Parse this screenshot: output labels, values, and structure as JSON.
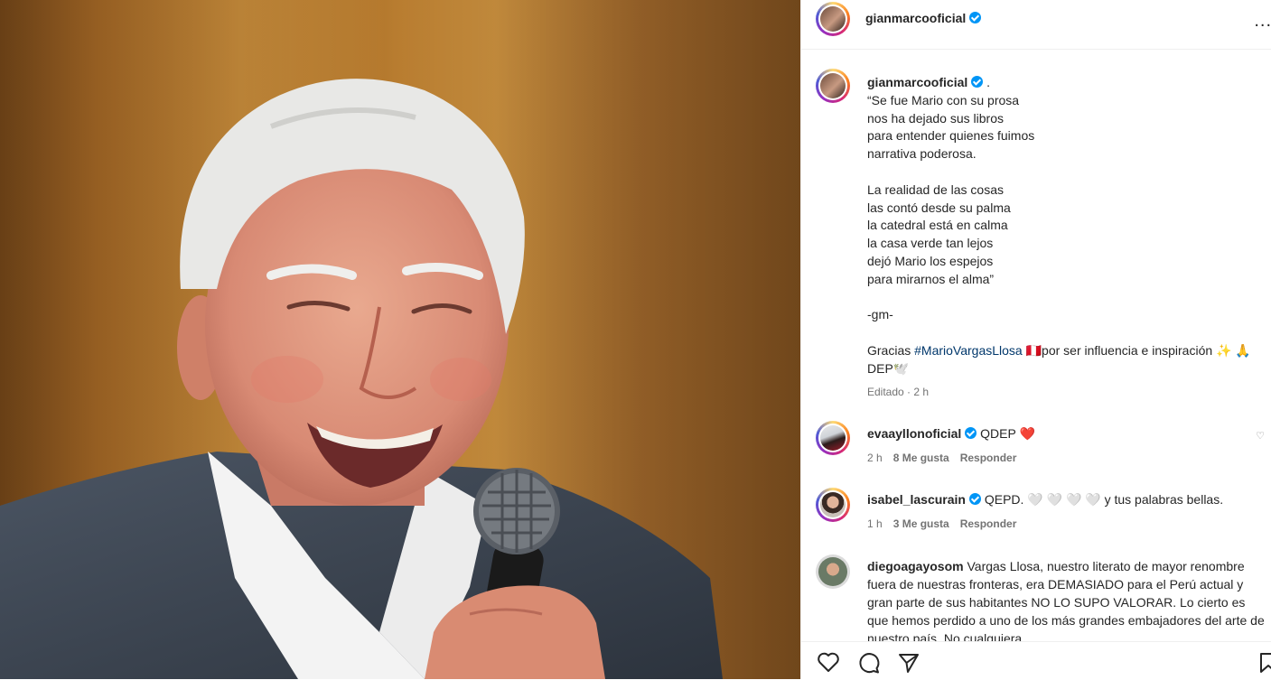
{
  "post": {
    "image_alt": "Mario Vargas Llosa smiling holding a microphone"
  },
  "header": {
    "username": "gianmarcooficial",
    "more_label": "..."
  },
  "caption": {
    "username": "gianmarcooficial",
    "suffix": " .",
    "lines": [
      "“Se fue Mario con su prosa",
      "nos ha dejado sus libros",
      "para entender quienes fuimos",
      "narrativa poderosa.",
      "",
      "La realidad de las cosas",
      "las contó desde su palma",
      "la catedral está en calma",
      "la casa verde tan lejos",
      "dejó Mario los espejos",
      "para mirarnos el alma”",
      "",
      "-gm-",
      ""
    ],
    "thanks_prefix": "Gracias ",
    "hashtag": "#MarioVargasLlosa",
    "thanks_suffix": " 🇵🇪por ser influencia e inspiración ✨ 🙏",
    "dep": "DEP🕊️",
    "edited": "Editado · 2 h"
  },
  "comments": [
    {
      "username": "evaayllonoficial",
      "text": " QDEP ",
      "emoji": "❤️",
      "time": "2 h",
      "likes": "8 Me gusta",
      "reply": "Responder"
    },
    {
      "username": "isabel_lascurain",
      "text": " QEPD. 🤍 🤍 🤍 🤍  y tus palabras bellas.",
      "time": "1 h",
      "likes": "3 Me gusta",
      "reply": "Responder"
    },
    {
      "username": "diegoagayosom",
      "text": " Vargas Llosa, nuestro literato de mayor renombre fuera de nuestras fronteras, era DEMASIADO para el Perú actual y gran parte de sus habitantes NO LO SUPO VALORAR. Lo cierto es que hemos perdido a uno de los más grandes embajadores del arte de nuestro país. No cualquiera"
    }
  ],
  "actions": {
    "like_icon": "heart-outline",
    "comment_icon": "speech-bubble",
    "share_icon": "paper-plane",
    "save_icon": "bookmark"
  },
  "colors": {
    "link": "#00376b",
    "verified": "#0095f6",
    "heart": "#ed4956",
    "meta": "#737373"
  }
}
